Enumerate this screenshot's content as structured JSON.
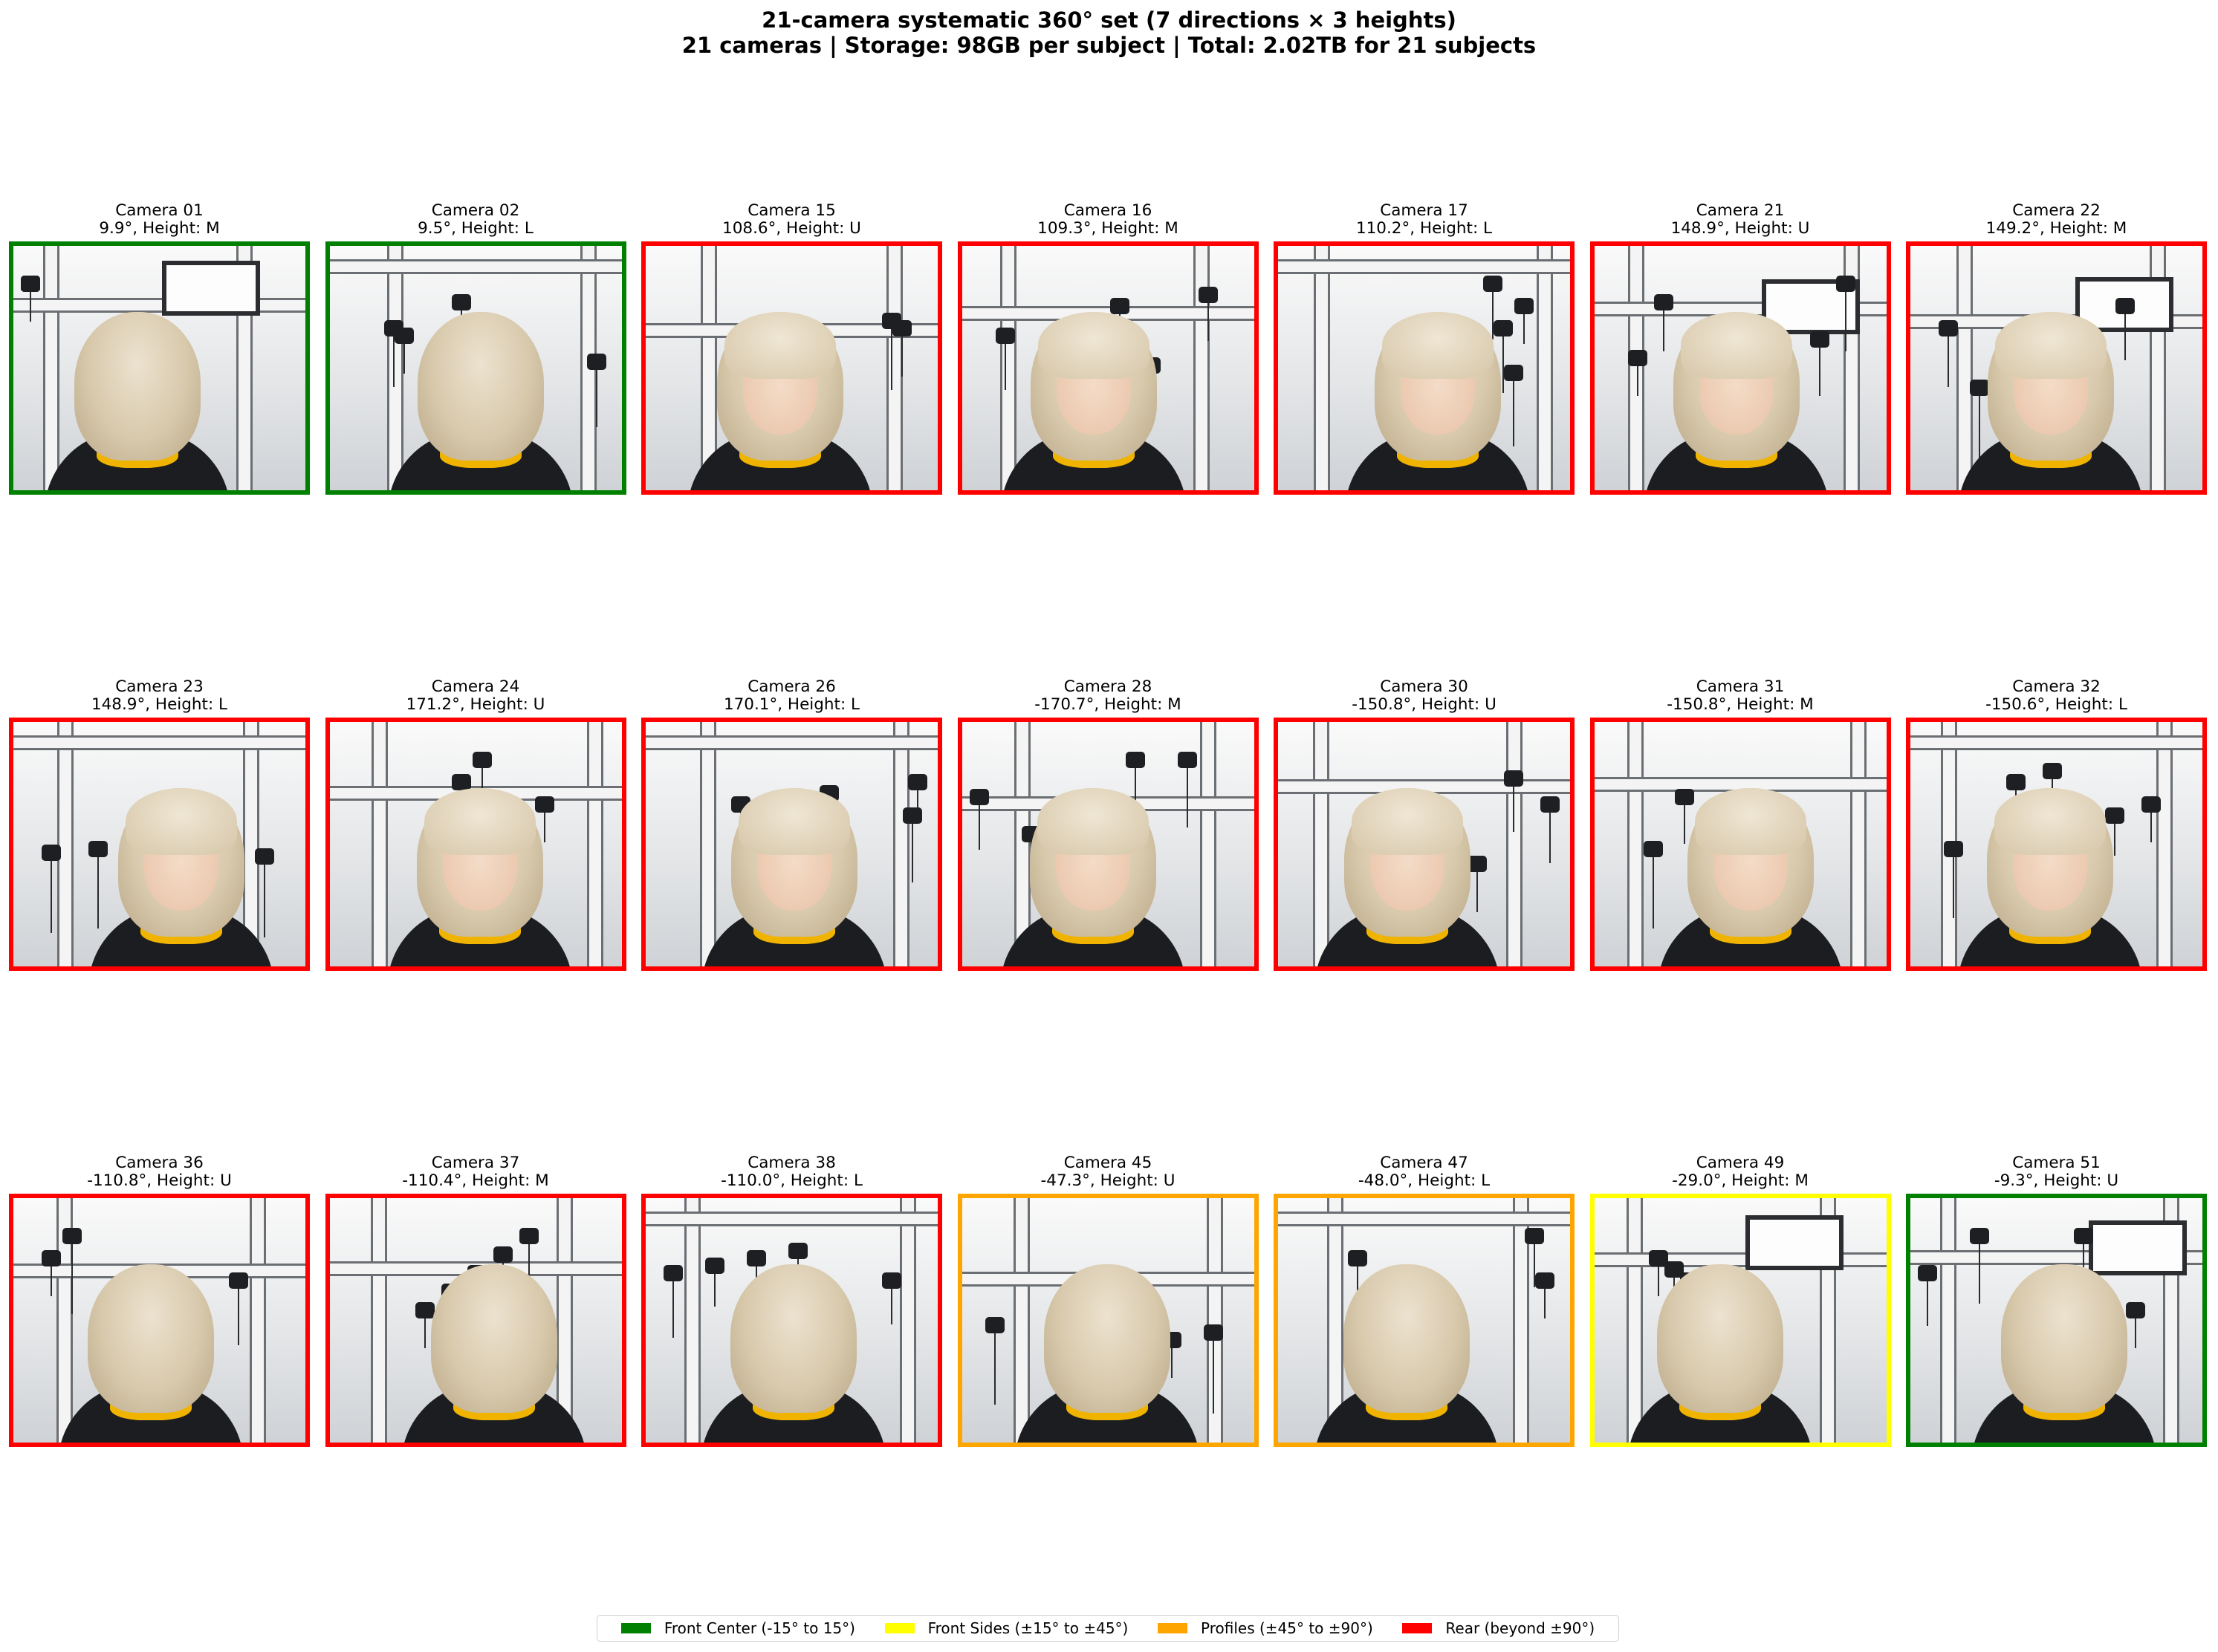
{
  "header": {
    "title_line1": "21-camera systematic 360° set (7 directions × 3 heights)",
    "title_line2": "21 cameras | Storage: 98GB per subject | Total: 2.02TB for 21 subjects"
  },
  "categories": {
    "front_center": {
      "color": "#008000"
    },
    "front_sides": {
      "color": "#ffff00"
    },
    "profiles": {
      "color": "#ffa500"
    },
    "rear": {
      "color": "#ff0000"
    }
  },
  "cameras": [
    {
      "name": "Camera 01",
      "detail": "9.9°, Height: M",
      "category": "front_center",
      "view": "back",
      "rig": "monitor"
    },
    {
      "name": "Camera 02",
      "detail": "9.5°, Height: L",
      "category": "front_center",
      "view": "back",
      "rig": "dome"
    },
    {
      "name": "Camera 15",
      "detail": "108.6°, Height: U",
      "category": "rear",
      "view": "face",
      "rig": "rig"
    },
    {
      "name": "Camera 16",
      "detail": "109.3°, Height: M",
      "category": "rear",
      "view": "face",
      "rig": "rig"
    },
    {
      "name": "Camera 17",
      "detail": "110.2°, Height: L",
      "category": "rear",
      "view": "face",
      "rig": "dome"
    },
    {
      "name": "Camera 21",
      "detail": "148.9°, Height: U",
      "category": "rear",
      "view": "face",
      "rig": "monitor"
    },
    {
      "name": "Camera 22",
      "detail": "149.2°, Height: M",
      "category": "rear",
      "view": "face",
      "rig": "monitor"
    },
    {
      "name": "Camera 23",
      "detail": "148.9°, Height: L",
      "category": "rear",
      "view": "face",
      "rig": "dome"
    },
    {
      "name": "Camera 24",
      "detail": "171.2°, Height: U",
      "category": "rear",
      "view": "face",
      "rig": "rig"
    },
    {
      "name": "Camera 26",
      "detail": "170.1°, Height: L",
      "category": "rear",
      "view": "face",
      "rig": "dome"
    },
    {
      "name": "Camera 28",
      "detail": "-170.7°, Height: M",
      "category": "rear",
      "view": "face",
      "rig": "rig"
    },
    {
      "name": "Camera 30",
      "detail": "-150.8°, Height: U",
      "category": "rear",
      "view": "face",
      "rig": "rig"
    },
    {
      "name": "Camera 31",
      "detail": "-150.8°, Height: M",
      "category": "rear",
      "view": "face",
      "rig": "rig"
    },
    {
      "name": "Camera 32",
      "detail": "-150.6°, Height: L",
      "category": "rear",
      "view": "face",
      "rig": "dome"
    },
    {
      "name": "Camera 36",
      "detail": "-110.8°, Height: U",
      "category": "rear",
      "view": "back",
      "rig": "rig"
    },
    {
      "name": "Camera 37",
      "detail": "-110.4°, Height: M",
      "category": "rear",
      "view": "back",
      "rig": "rig"
    },
    {
      "name": "Camera 38",
      "detail": "-110.0°, Height: L",
      "category": "rear",
      "view": "back",
      "rig": "dome"
    },
    {
      "name": "Camera 45",
      "detail": "-47.3°, Height: U",
      "category": "profiles",
      "view": "back",
      "rig": "rig"
    },
    {
      "name": "Camera 47",
      "detail": "-48.0°, Height: L",
      "category": "profiles",
      "view": "back",
      "rig": "dome"
    },
    {
      "name": "Camera 49",
      "detail": "-29.0°, Height: M",
      "category": "front_sides",
      "view": "back",
      "rig": "monitor"
    },
    {
      "name": "Camera 51",
      "detail": "-9.3°, Height: U",
      "category": "front_center",
      "view": "back",
      "rig": "monitor"
    }
  ],
  "legend": [
    {
      "label": "Front Center (-15° to 15°)",
      "category": "front_center"
    },
    {
      "label": "Front Sides (±15° to ±45°)",
      "category": "front_sides"
    },
    {
      "label": "Profiles (±45° to ±90°)",
      "category": "profiles"
    },
    {
      "label": "Rear (beyond ±90°)",
      "category": "rear"
    }
  ]
}
